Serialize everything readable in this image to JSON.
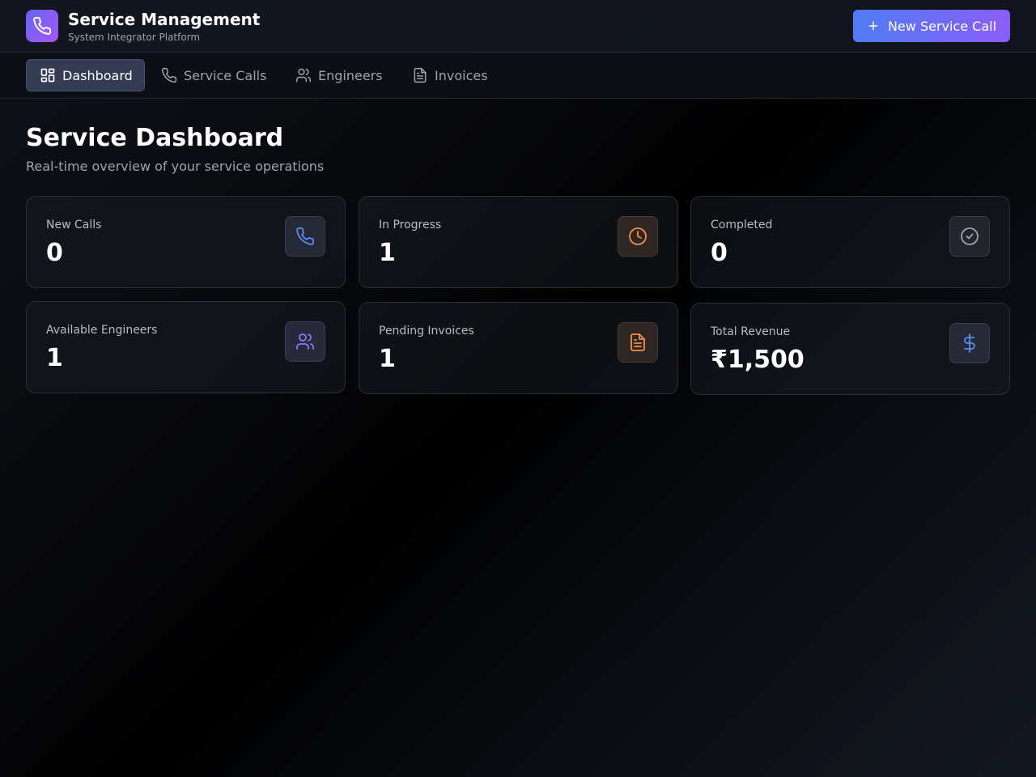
{
  "header": {
    "title": "Service Management",
    "subtitle": "System Integrator Platform",
    "new_call_label": "New Service Call"
  },
  "nav": {
    "items": [
      {
        "label": "Dashboard",
        "icon": "grid-icon",
        "active": true
      },
      {
        "label": "Service Calls",
        "icon": "phone-icon",
        "active": false
      },
      {
        "label": "Engineers",
        "icon": "users-icon",
        "active": false
      },
      {
        "label": "Invoices",
        "icon": "document-icon",
        "active": false
      }
    ]
  },
  "main": {
    "title": "Service Dashboard",
    "subtitle": "Real-time overview of your service operations"
  },
  "stats": [
    {
      "label": "New Calls",
      "value": "0",
      "icon": "phone-icon",
      "icon_color": "#5b8def"
    },
    {
      "label": "In Progress",
      "value": "1",
      "icon": "clock-icon",
      "icon_color": "#f2904a"
    },
    {
      "label": "Completed",
      "value": "0",
      "icon": "check-circle-icon",
      "icon_color": "#9ca3af"
    },
    {
      "label": "Available Engineers",
      "value": "1",
      "icon": "users-icon",
      "icon_color": "#8b7cf6"
    },
    {
      "label": "Pending Invoices",
      "value": "1",
      "icon": "document-icon",
      "icon_color": "#f2904a"
    },
    {
      "label": "Total Revenue",
      "value": "₹1,500",
      "icon": "dollar-icon",
      "icon_color": "#5b8def"
    }
  ],
  "colors": {
    "accent_start": "#4f7cf5",
    "accent_end": "#8b5cf6",
    "logo_start": "#6366f1",
    "logo_end": "#a855f7"
  }
}
